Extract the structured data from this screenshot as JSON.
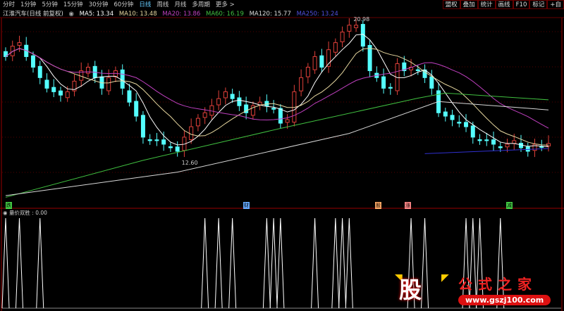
{
  "topbar": {
    "periods": [
      "分时",
      "1分钟",
      "5分钟",
      "15分钟",
      "30分钟",
      "60分钟",
      "日线",
      "周线",
      "月线",
      "多周期",
      "更多 >"
    ],
    "active": "日线",
    "tools": [
      "盟权",
      "叠加",
      "统计",
      "画线",
      "F10",
      "标记",
      "+自"
    ]
  },
  "info": {
    "title": "江淮汽车(日线 前复权)",
    "ma5": "MA5: 13.34",
    "ma10": "MA10: 13.48",
    "ma20": "MA20: 13.86",
    "ma60": "MA60: 16.19",
    "ma120": "MA120: 15.77",
    "ma250": "MA250: 13.24"
  },
  "colors": {
    "up": "#e0403a",
    "down": "#54ffff",
    "ma5": "#ffffff",
    "ma10": "#e8d8a0",
    "ma20": "#c040c0",
    "ma60": "#40c040",
    "ma120": "#d8d8d8",
    "ma250": "#3030d0"
  },
  "annotations": {
    "high": "20.98",
    "low": "12.60"
  },
  "markers": [
    {
      "label": "跌",
      "color": "#4c4"
    },
    {
      "label": "财",
      "color": "#6af"
    },
    {
      "label": "股",
      "color": "#fa6"
    },
    {
      "label": "涨",
      "color": "#f88"
    },
    {
      "label": "减",
      "color": "#4c4"
    }
  ],
  "sub": {
    "title": "量价双胜 : 0.00"
  },
  "logo": {
    "char": "股",
    "name": "公式之家",
    "url": "www.gszj100.com"
  },
  "chart_data": {
    "type": "candlestick",
    "ylim": [
      10.0,
      21.3
    ],
    "close": [
      18.77,
      19.39,
      19.6,
      18.77,
      18.14,
      17.52,
      16.89,
      16.68,
      16.48,
      16.68,
      17.31,
      17.93,
      18.14,
      17.52,
      16.89,
      17.52,
      17.93,
      16.89,
      16.06,
      15.23,
      13.98,
      13.77,
      13.77,
      13.56,
      13.35,
      13.14,
      13.98,
      14.6,
      15.1,
      15.43,
      15.85,
      16.27,
      16.68,
      16.27,
      15.85,
      15.43,
      15.85,
      16.06,
      15.85,
      15.64,
      14.81,
      15.02,
      16.68,
      17.52,
      18.14,
      18.77,
      18.14,
      19.18,
      19.6,
      20.23,
      20.64,
      20.64,
      19.39,
      17.93,
      17.52,
      16.89,
      16.89,
      18.35,
      17.93,
      18.14,
      17.93,
      17.52,
      16.89,
      15.43,
      15.23,
      15.02,
      14.81,
      14.6,
      13.98,
      13.77,
      13.77,
      13.56,
      13.35,
      13.56,
      13.77,
      13.35,
      13.14,
      13.56,
      13.4,
      13.6
    ],
    "ma60": [
      [
        0,
        10.4
      ],
      [
        20,
        12.6
      ],
      [
        40,
        14.5
      ],
      [
        60,
        16.3
      ],
      [
        64,
        16.6
      ],
      [
        79,
        16.2
      ]
    ],
    "ma120": [
      [
        0,
        10.5
      ],
      [
        25,
        11.9
      ],
      [
        50,
        14.2
      ],
      [
        63,
        16.1
      ],
      [
        79,
        15.6
      ]
    ],
    "ma250": [
      [
        61,
        13.0
      ],
      [
        79,
        13.3
      ]
    ],
    "signals": [
      0,
      2,
      5,
      29,
      31,
      33,
      38,
      39,
      40,
      45,
      48,
      49,
      50,
      59,
      61,
      67,
      68,
      69,
      72
    ]
  }
}
